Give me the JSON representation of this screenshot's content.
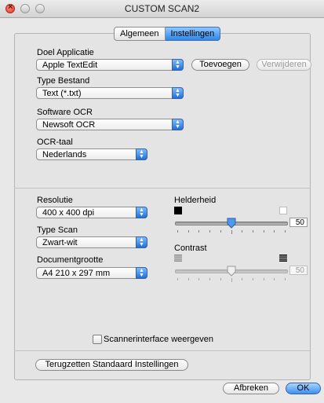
{
  "window": {
    "title": "CUSTOM SCAN2"
  },
  "tabs": [
    {
      "label": "Algemeen",
      "active": false
    },
    {
      "label": "Instellingen",
      "active": true
    }
  ],
  "app_target": {
    "label": "Doel Applicatie",
    "value": "Apple TextEdit",
    "add_label": "Toevoegen",
    "remove_label": "Verwijderen"
  },
  "file_type": {
    "label": "Type Bestand",
    "value": "Text (*.txt)"
  },
  "ocr_software": {
    "label": "Software OCR",
    "value": "Newsoft OCR"
  },
  "ocr_language": {
    "label": "OCR-taal",
    "value": "Nederlands"
  },
  "resolution": {
    "label": "Resolutie",
    "value": "400 x 400 dpi"
  },
  "scan_type": {
    "label": "Type Scan",
    "value": "Zwart-wit"
  },
  "document_size": {
    "label": "Documentgrootte",
    "value": "A4  210 x 297 mm"
  },
  "brightness": {
    "label": "Helderheid",
    "value": "50",
    "level_percent": 50,
    "enabled": true
  },
  "contrast": {
    "label": "Contrast",
    "value": "50",
    "level_percent": 50,
    "enabled": false
  },
  "scanner_interface": {
    "label": "Scannerinterface weergeven",
    "checked": false
  },
  "reset_button": {
    "label": "Terugzetten Standaard Instellingen"
  },
  "footer": {
    "cancel_label": "Afbreken",
    "ok_label": "OK"
  },
  "colors": {
    "accent": "#2f86e8",
    "disabled_text": "#9a9a9a"
  }
}
